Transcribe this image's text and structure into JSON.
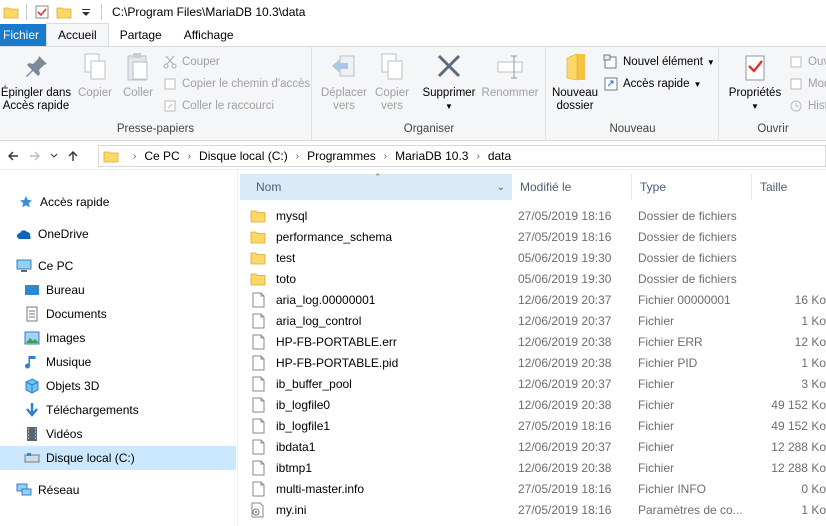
{
  "window": {
    "title_path": "C:\\Program Files\\MariaDB 10.3\\data"
  },
  "tabs": [
    {
      "label": "Fichier"
    },
    {
      "label": "Accueil"
    },
    {
      "label": "Partage"
    },
    {
      "label": "Affichage"
    }
  ],
  "ribbon": {
    "clipboard": {
      "label": "Presse-papiers",
      "pin_line1": "Épingler dans",
      "pin_line2": "Accès rapide",
      "copy": "Copier",
      "paste": "Coller",
      "cut": "Couper",
      "copy_path": "Copier le chemin d'accès",
      "paste_shortcut": "Coller le raccourci"
    },
    "organize": {
      "label": "Organiser",
      "move_line1": "Déplacer",
      "move_line2": "vers",
      "copyto_line1": "Copier",
      "copyto_line2": "vers",
      "delete": "Supprimer",
      "rename": "Renommer"
    },
    "new": {
      "label": "Nouveau",
      "folder_line1": "Nouveau",
      "folder_line2": "dossier",
      "new_item": "Nouvel élément",
      "quick_access": "Accès rapide"
    },
    "open": {
      "label": "Ouvrir",
      "properties": "Propriétés",
      "open_short": "Ouv",
      "modify_short": "Mod",
      "history_short": "Hist"
    }
  },
  "address": {
    "crumbs": [
      "Ce PC",
      "Disque local (C:)",
      "Programmes",
      "MariaDB 10.3",
      "data"
    ]
  },
  "sidebar": {
    "items": [
      {
        "label": "Accès rapide"
      },
      {
        "label": "OneDrive"
      },
      {
        "label": "Ce PC"
      },
      {
        "label": "Bureau"
      },
      {
        "label": "Documents"
      },
      {
        "label": "Images"
      },
      {
        "label": "Musique"
      },
      {
        "label": "Objets 3D"
      },
      {
        "label": "Téléchargements"
      },
      {
        "label": "Vidéos"
      },
      {
        "label": "Disque local (C:)"
      },
      {
        "label": "Réseau"
      }
    ]
  },
  "columns": {
    "name": "Nom",
    "date": "Modifié le",
    "type": "Type",
    "size": "Taille"
  },
  "files": [
    {
      "name": "mysql",
      "date": "27/05/2019 18:16",
      "type": "Dossier de fichiers",
      "size": "",
      "kind": "folder"
    },
    {
      "name": "performance_schema",
      "date": "27/05/2019 18:16",
      "type": "Dossier de fichiers",
      "size": "",
      "kind": "folder"
    },
    {
      "name": "test",
      "date": "05/06/2019 19:30",
      "type": "Dossier de fichiers",
      "size": "",
      "kind": "folder"
    },
    {
      "name": "toto",
      "date": "05/06/2019 19:30",
      "type": "Dossier de fichiers",
      "size": "",
      "kind": "folder"
    },
    {
      "name": "aria_log.00000001",
      "date": "12/06/2019 20:37",
      "type": "Fichier 00000001",
      "size": "16 Ko",
      "kind": "file"
    },
    {
      "name": "aria_log_control",
      "date": "12/06/2019 20:37",
      "type": "Fichier",
      "size": "1 Ko",
      "kind": "file"
    },
    {
      "name": "HP-FB-PORTABLE.err",
      "date": "12/06/2019 20:38",
      "type": "Fichier ERR",
      "size": "12 Ko",
      "kind": "file"
    },
    {
      "name": "HP-FB-PORTABLE.pid",
      "date": "12/06/2019 20:38",
      "type": "Fichier PID",
      "size": "1 Ko",
      "kind": "file"
    },
    {
      "name": "ib_buffer_pool",
      "date": "12/06/2019 20:37",
      "type": "Fichier",
      "size": "3 Ko",
      "kind": "file"
    },
    {
      "name": "ib_logfile0",
      "date": "12/06/2019 20:38",
      "type": "Fichier",
      "size": "49 152 Ko",
      "kind": "file"
    },
    {
      "name": "ib_logfile1",
      "date": "27/05/2019 18:16",
      "type": "Fichier",
      "size": "49 152 Ko",
      "kind": "file"
    },
    {
      "name": "ibdata1",
      "date": "12/06/2019 20:37",
      "type": "Fichier",
      "size": "12 288 Ko",
      "kind": "file"
    },
    {
      "name": "ibtmp1",
      "date": "12/06/2019 20:38",
      "type": "Fichier",
      "size": "12 288 Ko",
      "kind": "file"
    },
    {
      "name": "multi-master.info",
      "date": "27/05/2019 18:16",
      "type": "Fichier INFO",
      "size": "0 Ko",
      "kind": "file"
    },
    {
      "name": "my.ini",
      "date": "27/05/2019 18:16",
      "type": "Paramètres de co...",
      "size": "1 Ko",
      "kind": "ini"
    }
  ],
  "colors": {
    "accent": "#1979ca",
    "folder": "#ffd766",
    "selected": "#cce8ff",
    "header_sorted": "#d9ebf9"
  }
}
